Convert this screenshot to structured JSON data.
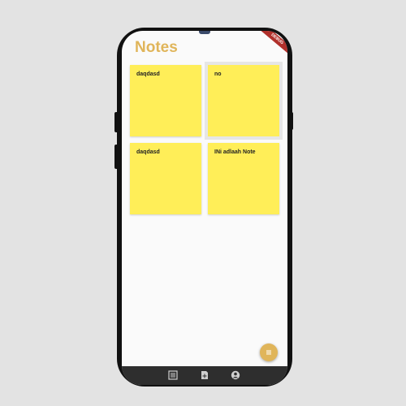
{
  "app": {
    "title": "Notes",
    "debug_banner": "DEBUG"
  },
  "notes": [
    {
      "text": "daqdasd"
    },
    {
      "text": "no"
    },
    {
      "text": "daqdasd"
    },
    {
      "text": "INi adlaah Note"
    }
  ],
  "fab": {
    "icon": "menu-icon"
  },
  "bottom_nav": {
    "items": [
      {
        "icon": "list-icon"
      },
      {
        "icon": "add-document-icon"
      },
      {
        "icon": "account-icon"
      }
    ]
  },
  "colors": {
    "accent": "#e0b55a",
    "note": "#ffee58",
    "nav_bar": "#2e2e2e",
    "debug_ribbon": "#b0302b"
  }
}
